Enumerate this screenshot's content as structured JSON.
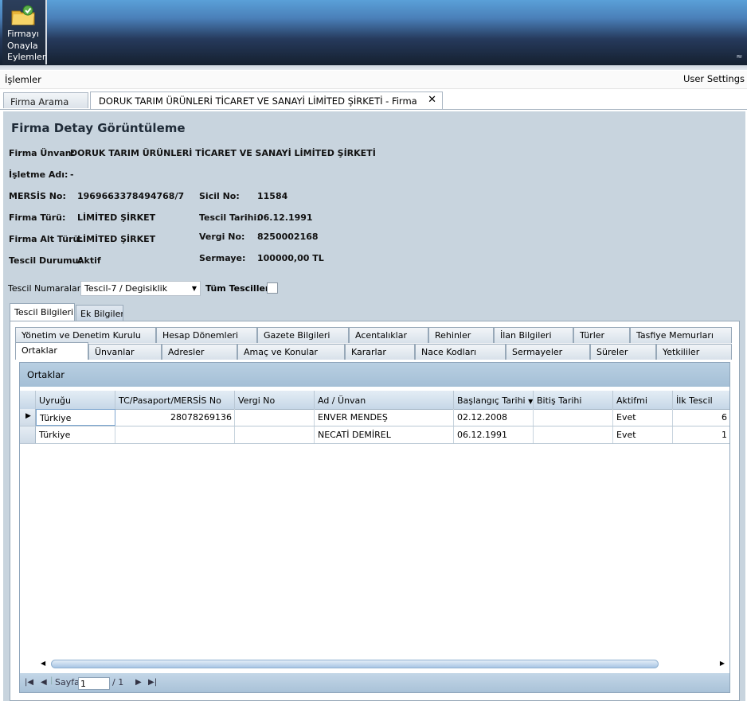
{
  "ribbon": {
    "approve_button_label": "Firmayı Onayla Eylemler",
    "collapse_icon": "chevron-double-up-icon"
  },
  "menubar": {
    "left_label": "İşlemler",
    "right_label": "User Settings"
  },
  "doc_tabs": [
    {
      "label": "Firma Arama"
    },
    {
      "label": "DORUK TARIM ÜRÜNLERİ TİCARET VE SANAYİ LİMİTED ŞİRKETİ - Firma"
    }
  ],
  "page_title": "Firma Detay Görüntüleme",
  "fields": {
    "unvan_label": "Firma Ünvan:",
    "unvan_value": "DORUK TARIM ÜRÜNLERİ TİCARET VE SANAYİ LİMİTED ŞİRKETİ",
    "isletme_label": "İşletme Adı:",
    "isletme_value": "-",
    "mersis_label": "MERSİS No:",
    "mersis_value": "1969663378494768/7",
    "sicil_label": "Sicil No:",
    "sicil_value": "11584",
    "turu_label": "Firma Türü:",
    "turu_value": "LİMİTED ŞİRKET",
    "tescil_tarihi_label": "Tescil Tarihi:",
    "tescil_tarihi_value": "06.12.1991",
    "alt_turu_label": "Firma Alt Türü:",
    "alt_turu_value": "LİMİTED ŞİRKET",
    "vergi_label": "Vergi No:",
    "vergi_value": "8250002168",
    "durum_label": "Tescil Durumu:",
    "durum_value": "Aktif",
    "sermaye_label": "Sermaye:",
    "sermaye_value": "100000,00 TL"
  },
  "tescil_filter": {
    "label": "Tescil Numaraları:",
    "selected": "Tescil-7 / Degisiklik",
    "tum_label": "Tüm Tesciller:",
    "tum_checked": false
  },
  "inner_tabs": [
    "Tescil Bilgileri",
    "Ek Bilgiler"
  ],
  "sub_tabs_row1": [
    "Yönetim ve Denetim Kurulu",
    "Hesap Dönemleri",
    "Gazete Bilgileri",
    "Acentalıklar",
    "Rehinler",
    "İlan Bilgileri",
    "Türler",
    "Tasfiye Memurları"
  ],
  "sub_tabs_row2": [
    "Ortaklar",
    "Ünvanlar",
    "Adresler",
    "Amaç ve Konular",
    "Kararlar",
    "Nace Kodları",
    "Sermayeler",
    "Süreler",
    "Yetkililer"
  ],
  "grid": {
    "caption": "Ortaklar",
    "columns": [
      "Uyruğu",
      "TC/Pasaport/MERSİS No",
      "Vergi No",
      "Ad / Ünvan",
      "Başlangıç Tarihi",
      "Bitiş Tarihi",
      "Aktifmi",
      "İlk Tescil"
    ],
    "rows": [
      [
        "Türkiye",
        "28078269136",
        "",
        "ENVER MENDEŞ",
        "02.12.2008",
        "",
        "Evet",
        "6"
      ],
      [
        "Türkiye",
        "",
        "",
        "NECATİ DEMİREL",
        "06.12.1991",
        "",
        "Evet",
        "1"
      ]
    ]
  },
  "pager": {
    "page_label": "Sayfa",
    "page_value": "1",
    "total": "/ 1"
  }
}
